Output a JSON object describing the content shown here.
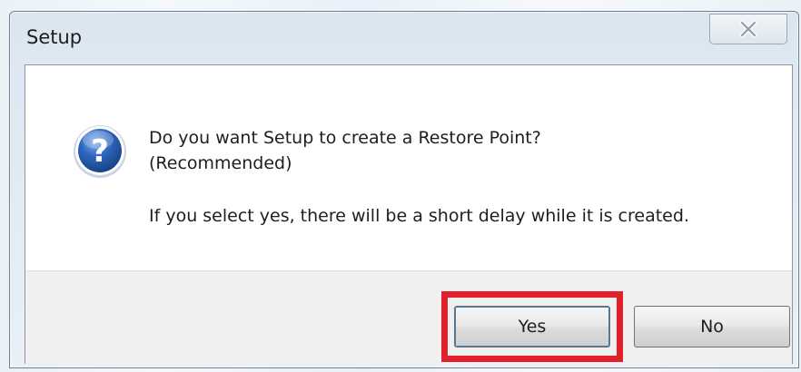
{
  "window": {
    "title": "Setup",
    "close_icon": "close-icon"
  },
  "dialog": {
    "icon": "question-icon",
    "question_line1": "Do you want Setup to create a Restore Point?",
    "question_line2": "(Recommended)",
    "detail": "If you select yes, there will be a short delay while it is created."
  },
  "buttons": {
    "yes_label": "Yes",
    "no_label": "No"
  },
  "annotation": {
    "highlight_color": "#e0202a",
    "highlights": "yes-button"
  },
  "colors": {
    "icon_blue": "#1f4f9a",
    "button_bar": "#f0f0f0",
    "title_bar": "#dbe6f1"
  }
}
